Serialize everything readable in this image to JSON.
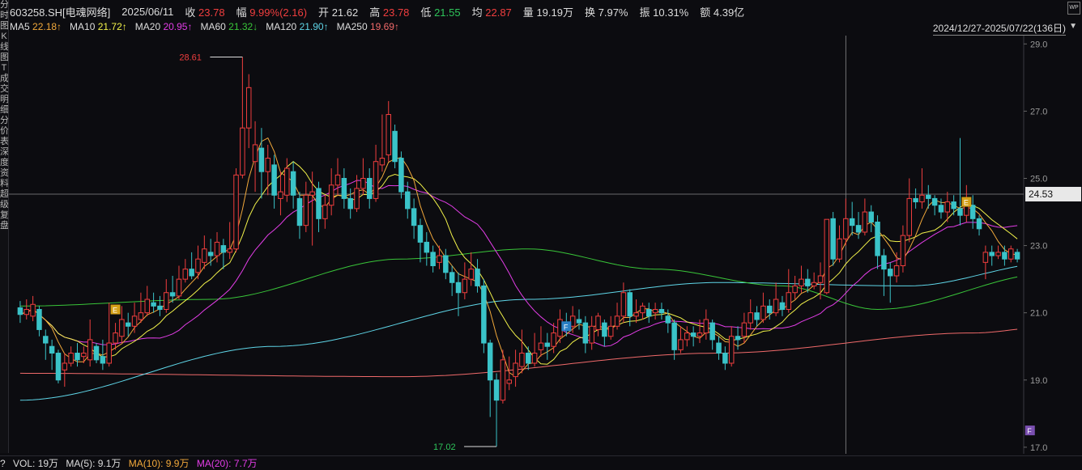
{
  "sidebar": [
    "分",
    "时",
    "图",
    "K",
    "线",
    "图",
    "T",
    "",
    "",
    "",
    "",
    "成",
    "交",
    "明",
    "细",
    "分",
    "价",
    "表",
    "深",
    "度",
    "资",
    "料",
    "超",
    "级",
    "复",
    "盘"
  ],
  "header": {
    "symbol": "603258.SH[电魂网络]",
    "date": "2025/06/11",
    "close_label": "收",
    "close_value": "23.78",
    "change_label": "幅",
    "change_value": "9.99%(2.16)",
    "open_label": "开",
    "open_value": "21.62",
    "high_label": "高",
    "high_value": "23.78",
    "low_label": "低",
    "low_value": "21.55",
    "avg_label": "均",
    "avg_value": "22.87",
    "vol_label": "量",
    "vol_value": "19.19万",
    "turn_label": "换",
    "turn_value": "7.97%",
    "amp_label": "振",
    "amp_value": "10.31%",
    "amt_label": "额",
    "amt_value": "4.39亿"
  },
  "ma_legend": [
    {
      "name": "MA5",
      "value": "22.18↑",
      "color": "#f2a93b"
    },
    {
      "name": "MA10",
      "value": "21.72↑",
      "color": "#f2f24a"
    },
    {
      "name": "MA20",
      "value": "20.95↑",
      "color": "#e23de6"
    },
    {
      "name": "MA60",
      "value": "21.32↓",
      "color": "#39c539"
    },
    {
      "name": "MA120",
      "value": "21.90↑",
      "color": "#5fd6e8"
    },
    {
      "name": "MA250",
      "value": "19.69↑",
      "color": "#f06a6a"
    }
  ],
  "range_text": "2024/12/27-2025/07/22(136日)",
  "corner_text": "WP",
  "volume_bar": {
    "collapse": "?",
    "vol": "VOL: 19万",
    "ma5": "MA(5): 9.1万",
    "ma10": "MA(10): 9.9万",
    "ma20": "MA(20): 7.7万",
    "colors": {
      "ma10": "#f2a93b",
      "ma20": "#e23de6"
    }
  },
  "chart_data": {
    "type": "candlestick",
    "y_range": [
      16.9,
      29.2
    ],
    "y_ticks": [
      "29.0",
      "27.0",
      "25.0",
      "23.0",
      "21.0",
      "19.0",
      "17.0"
    ],
    "crosshair_price": "24.53",
    "max_label": "28.61",
    "min_label": "17.02",
    "markers": [
      {
        "letter": "E",
        "index": 15,
        "price": 21.1,
        "color": "#d4a017"
      },
      {
        "letter": "F",
        "index": 86,
        "price": 20.6,
        "color": "#2a7fc4"
      },
      {
        "letter": "E",
        "index": 149,
        "price": 24.3,
        "color": "#d4a017"
      },
      {
        "letter": "F",
        "index": 159,
        "price": 17.5,
        "color": "#7a4fb0"
      }
    ],
    "candles": [
      [
        21.15,
        20.95,
        21.35,
        20.7
      ],
      [
        20.95,
        21.1,
        21.4,
        20.8
      ],
      [
        20.9,
        21.25,
        21.5,
        20.75
      ],
      [
        21.1,
        20.5,
        21.2,
        20.3
      ],
      [
        20.3,
        20.1,
        20.5,
        19.6
      ],
      [
        20.0,
        19.8,
        20.2,
        19.3
      ],
      [
        19.8,
        19.0,
        19.9,
        18.9
      ],
      [
        19.3,
        19.5,
        19.8,
        18.8
      ],
      [
        19.5,
        19.8,
        20.0,
        19.4
      ],
      [
        19.8,
        19.6,
        20.1,
        19.4
      ],
      [
        19.7,
        19.8,
        20.0,
        19.5
      ],
      [
        19.6,
        20.2,
        20.8,
        19.4
      ],
      [
        20.0,
        19.6,
        20.1,
        19.5
      ],
      [
        19.7,
        19.5,
        20.2,
        19.3
      ],
      [
        19.5,
        20.1,
        21.3,
        19.4
      ],
      [
        20.1,
        20.4,
        20.7,
        19.9
      ],
      [
        20.3,
        20.8,
        21.2,
        20.1
      ],
      [
        20.7,
        20.6,
        21.0,
        20.3
      ],
      [
        20.6,
        20.9,
        21.3,
        20.4
      ],
      [
        20.8,
        21.0,
        21.6,
        20.7
      ],
      [
        21.0,
        21.4,
        21.8,
        20.9
      ],
      [
        21.3,
        21.2,
        21.6,
        21.0
      ],
      [
        21.2,
        21.1,
        21.5,
        20.9
      ],
      [
        21.1,
        21.6,
        22.0,
        21.0
      ],
      [
        21.6,
        21.5,
        22.1,
        21.3
      ],
      [
        21.5,
        22.0,
        22.4,
        21.4
      ],
      [
        22.0,
        22.3,
        22.6,
        21.9
      ],
      [
        22.3,
        22.1,
        22.8,
        22.0
      ],
      [
        22.2,
        22.6,
        23.0,
        22.0
      ],
      [
        22.5,
        22.9,
        23.3,
        22.3
      ],
      [
        22.8,
        22.7,
        23.2,
        22.4
      ],
      [
        22.7,
        23.1,
        23.4,
        22.5
      ],
      [
        23.0,
        22.8,
        23.2,
        22.3
      ],
      [
        22.8,
        22.9,
        23.7,
        22.6
      ],
      [
        22.9,
        25.1,
        25.3,
        22.8
      ],
      [
        25.1,
        26.5,
        28.61,
        25.0
      ],
      [
        26.5,
        27.7,
        28.1,
        25.9
      ],
      [
        25.5,
        26.0,
        26.7,
        24.6
      ],
      [
        25.9,
        25.2,
        26.5,
        24.4
      ],
      [
        25.2,
        25.6,
        26.0,
        24.5
      ],
      [
        25.4,
        24.5,
        25.7,
        24.1
      ],
      [
        24.4,
        24.6,
        25.2,
        23.9
      ],
      [
        24.5,
        25.3,
        25.6,
        24.3
      ],
      [
        25.2,
        24.5,
        25.5,
        24.1
      ],
      [
        24.4,
        23.6,
        24.6,
        23.2
      ],
      [
        23.6,
        24.5,
        24.9,
        23.4
      ],
      [
        24.5,
        24.6,
        25.2,
        23.0
      ],
      [
        24.7,
        23.8,
        24.9,
        23.4
      ],
      [
        23.8,
        24.2,
        24.5,
        23.5
      ],
      [
        24.2,
        24.8,
        25.3,
        23.9
      ],
      [
        24.8,
        25.1,
        25.6,
        24.5
      ],
      [
        25.0,
        24.4,
        25.3,
        24.1
      ],
      [
        24.4,
        24.1,
        24.7,
        23.8
      ],
      [
        24.1,
        24.7,
        25.1,
        24.0
      ],
      [
        24.7,
        25.0,
        25.6,
        24.5
      ],
      [
        25.0,
        24.4,
        25.3,
        24.1
      ],
      [
        24.4,
        25.5,
        26.0,
        24.3
      ],
      [
        25.4,
        25.6,
        26.9,
        25.2
      ],
      [
        25.7,
        26.9,
        27.3,
        25.5
      ],
      [
        26.4,
        25.5,
        26.6,
        25.3
      ],
      [
        25.6,
        24.6,
        25.8,
        24.4
      ],
      [
        24.6,
        24.1,
        24.9,
        23.8
      ],
      [
        24.1,
        23.6,
        24.4,
        23.2
      ],
      [
        23.6,
        23.1,
        23.8,
        22.5
      ],
      [
        23.1,
        22.8,
        23.4,
        22.4
      ],
      [
        22.8,
        22.4,
        23.0,
        22.2
      ],
      [
        22.5,
        22.7,
        23.0,
        22.3
      ],
      [
        22.7,
        22.2,
        22.9,
        22.0
      ],
      [
        22.2,
        21.9,
        22.4,
        21.5
      ],
      [
        21.9,
        21.6,
        22.2,
        20.9
      ],
      [
        21.6,
        22.0,
        22.5,
        21.4
      ],
      [
        22.0,
        22.3,
        22.8,
        21.8
      ],
      [
        22.3,
        21.8,
        22.6,
        21.6
      ],
      [
        21.8,
        20.1,
        22.0,
        19.8
      ],
      [
        20.1,
        19.0,
        20.2,
        17.9
      ],
      [
        19.0,
        18.4,
        19.2,
        17.02
      ],
      [
        18.4,
        19.6,
        19.9,
        18.3
      ],
      [
        18.9,
        19.0,
        19.7,
        18.7
      ],
      [
        19.1,
        19.5,
        19.9,
        18.8
      ],
      [
        19.4,
        19.8,
        20.5,
        19.2
      ],
      [
        19.8,
        19.5,
        20.0,
        19.3
      ],
      [
        19.5,
        19.8,
        20.4,
        19.4
      ],
      [
        19.9,
        20.1,
        20.6,
        19.7
      ],
      [
        20.1,
        20.0,
        20.4,
        19.6
      ],
      [
        20.0,
        20.4,
        20.7,
        19.8
      ],
      [
        20.3,
        20.8,
        21.1,
        20.1
      ],
      [
        20.7,
        20.5,
        21.0,
        20.3
      ],
      [
        20.6,
        20.9,
        21.2,
        20.4
      ],
      [
        20.8,
        20.7,
        21.1,
        20.5
      ],
      [
        20.7,
        20.1,
        20.9,
        19.8
      ],
      [
        20.1,
        20.6,
        20.9,
        19.9
      ],
      [
        20.5,
        20.9,
        21.0,
        20.3
      ],
      [
        20.7,
        20.3,
        20.8,
        20.0
      ],
      [
        20.3,
        20.6,
        20.9,
        20.2
      ],
      [
        20.6,
        20.9,
        21.3,
        20.5
      ],
      [
        20.9,
        21.6,
        21.9,
        20.7
      ],
      [
        21.6,
        20.9,
        21.7,
        20.6
      ],
      [
        20.9,
        21.0,
        21.4,
        20.7
      ],
      [
        21.0,
        21.2,
        21.3,
        20.8
      ],
      [
        21.1,
        20.9,
        21.3,
        20.7
      ],
      [
        21.0,
        21.1,
        21.3,
        20.8
      ],
      [
        21.1,
        21.0,
        21.3,
        20.8
      ],
      [
        20.9,
        20.7,
        21.1,
        20.4
      ],
      [
        20.7,
        19.9,
        20.8,
        19.6
      ],
      [
        19.9,
        20.2,
        20.6,
        19.8
      ],
      [
        20.2,
        20.4,
        20.6,
        20.0
      ],
      [
        20.4,
        20.3,
        20.6,
        20.0
      ],
      [
        20.3,
        20.4,
        20.8,
        20.1
      ],
      [
        20.4,
        20.8,
        21.1,
        20.2
      ],
      [
        20.7,
        20.2,
        20.8,
        19.9
      ],
      [
        20.1,
        19.8,
        20.3,
        19.6
      ],
      [
        19.8,
        19.5,
        20.0,
        19.3
      ],
      [
        19.5,
        20.3,
        20.6,
        19.4
      ],
      [
        20.3,
        20.2,
        20.6,
        19.9
      ],
      [
        20.3,
        20.7,
        21.0,
        20.1
      ],
      [
        20.7,
        21.0,
        21.4,
        20.5
      ],
      [
        21.0,
        20.8,
        21.2,
        20.6
      ],
      [
        20.8,
        21.2,
        21.6,
        20.7
      ],
      [
        21.2,
        21.0,
        21.4,
        20.8
      ],
      [
        21.0,
        21.4,
        21.9,
        20.9
      ],
      [
        21.3,
        21.1,
        21.5,
        20.9
      ],
      [
        21.1,
        21.6,
        22.3,
        21.0
      ],
      [
        21.6,
        21.8,
        22.1,
        21.4
      ],
      [
        21.8,
        22.0,
        22.4,
        21.6
      ],
      [
        22.0,
        21.8,
        22.3,
        21.6
      ],
      [
        21.8,
        21.9,
        22.2,
        21.7
      ],
      [
        21.9,
        22.1,
        22.5,
        21.4
      ],
      [
        21.6,
        23.78,
        23.78,
        21.55
      ],
      [
        23.8,
        22.6,
        24.0,
        22.4
      ],
      [
        22.6,
        23.2,
        23.6,
        22.5
      ],
      [
        23.2,
        23.8,
        24.4,
        23.0
      ],
      [
        23.8,
        23.6,
        24.3,
        23.3
      ],
      [
        23.6,
        23.4,
        24.0,
        23.2
      ],
      [
        23.4,
        24.0,
        24.4,
        23.3
      ],
      [
        24.0,
        23.7,
        24.2,
        23.4
      ],
      [
        23.7,
        22.7,
        23.9,
        22.3
      ],
      [
        22.7,
        22.3,
        22.9,
        21.5
      ],
      [
        22.3,
        22.1,
        22.5,
        21.3
      ],
      [
        22.1,
        22.4,
        22.8,
        21.9
      ],
      [
        22.4,
        23.3,
        23.6,
        22.2
      ],
      [
        23.3,
        24.4,
        25.0,
        23.1
      ],
      [
        24.4,
        24.3,
        24.7,
        24.1
      ],
      [
        24.3,
        24.5,
        25.3,
        24.1
      ],
      [
        24.5,
        24.4,
        24.8,
        24.1
      ],
      [
        24.4,
        24.2,
        24.5,
        23.9
      ],
      [
        24.2,
        24.0,
        24.4,
        23.8
      ],
      [
        24.0,
        24.3,
        24.6,
        23.7
      ],
      [
        24.3,
        24.1,
        24.5,
        23.9
      ],
      [
        24.1,
        23.9,
        26.2,
        23.6
      ],
      [
        23.9,
        24.4,
        24.8,
        23.7
      ],
      [
        24.2,
        23.8,
        24.5,
        23.5
      ],
      [
        23.8,
        23.5,
        23.9,
        23.3
      ],
      [
        22.5,
        22.8,
        23.0,
        22.0
      ],
      [
        22.8,
        22.7,
        23.0,
        22.4
      ],
      [
        22.7,
        22.8,
        23.0,
        22.6
      ],
      [
        22.8,
        22.6,
        23.0,
        22.4
      ],
      [
        22.6,
        22.9,
        23.0,
        22.5
      ],
      [
        22.8,
        22.6,
        22.9,
        22.5
      ]
    ],
    "ma250_anchor": [
      [
        0,
        19.2
      ],
      [
        60,
        19.1
      ],
      [
        110,
        19.8
      ],
      [
        150,
        20.4
      ],
      [
        163,
        20.6
      ]
    ],
    "ma120_anchor": [
      [
        0,
        18.4
      ],
      [
        40,
        20.0
      ],
      [
        80,
        21.4
      ],
      [
        110,
        21.9
      ],
      [
        140,
        21.8
      ],
      [
        163,
        22.5
      ]
    ],
    "ma60_anchor": [
      [
        0,
        21.2
      ],
      [
        30,
        21.4
      ],
      [
        60,
        22.6
      ],
      [
        80,
        22.9
      ],
      [
        100,
        22.3
      ],
      [
        120,
        21.8
      ],
      [
        135,
        21.1
      ],
      [
        163,
        22.2
      ]
    ]
  }
}
